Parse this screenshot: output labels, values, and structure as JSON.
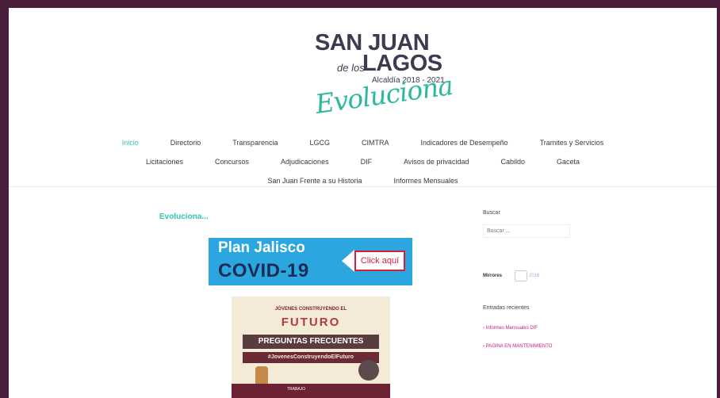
{
  "logo": {
    "line1": "SAN JUAN",
    "line2_small": "de los",
    "line2_big": "LAGOS",
    "line3": "Alcaldía 2018 - 2021",
    "script": "Evoluciona"
  },
  "nav": {
    "row1": [
      "Inicio",
      "Directorio",
      "Transparencia",
      "LGCG",
      "CIMTRA",
      "Indicadores de Desempeño",
      "Tramites y Servicios"
    ],
    "row2": [
      "Licitaciones",
      "Concursos",
      "Adjudicaciones",
      "DIF",
      "Avisos de privacidad",
      "Cabildo",
      "Gaceta"
    ],
    "row3": [
      "San Juan Frente a su Historia",
      "Informes Mensuales"
    ],
    "active": "Inicio"
  },
  "content": {
    "section_title": "Evoluciona...",
    "covid_banner": {
      "line1": "Plan Jalisco",
      "line2": "COVID-19",
      "button": "Click aquí"
    },
    "futuro_banner": {
      "top": "JÓVENES CONSTRUYENDO EL",
      "title": "FUTURO",
      "heading": "PREGUNTAS FRECUENTES",
      "hashtag": "#JovenesConstruyendoElFuturo",
      "footer": "TRABAJO"
    }
  },
  "sidebar": {
    "search_label": "Buscar",
    "search_placeholder": "Buscar ...",
    "mirrors_label": "Mirrores",
    "mirrors_link": "2016",
    "recent_label": "Entradas recientes",
    "recent": [
      "Informes Mensuales DIF",
      "PAGINA EN MANTENIMIENTO"
    ]
  },
  "colors": {
    "border": "#4a1d3d",
    "accent": "#2fc5b2",
    "link": "#c21c73"
  }
}
